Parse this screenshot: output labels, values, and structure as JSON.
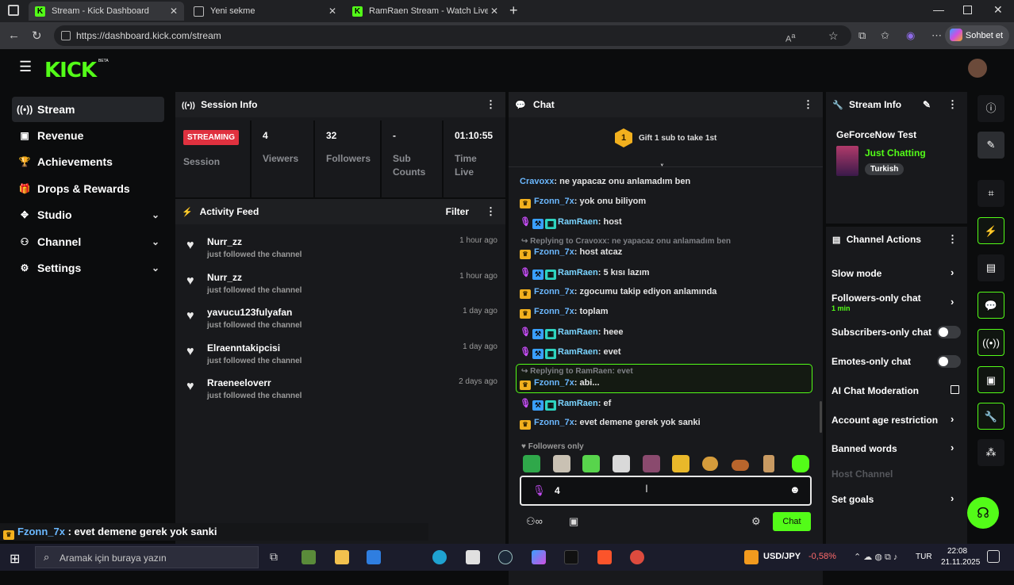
{
  "browser": {
    "tabs": [
      {
        "label": "Stream - Kick Dashboard",
        "active": true
      },
      {
        "label": "Yeni sekme",
        "active": false
      },
      {
        "label": "RamRaen Stream - Watch Live on",
        "active": false
      }
    ],
    "url": "https://dashboard.kick.com/stream",
    "sohbet_label": "Sohbet et"
  },
  "brand": {
    "logo": "KICK",
    "beta": "BETA",
    "accent": "#53fc18"
  },
  "sidebar": {
    "items": [
      {
        "label": "Stream",
        "icon": "broadcast-icon",
        "active": true
      },
      {
        "label": "Revenue",
        "icon": "wallet-icon"
      },
      {
        "label": "Achievements",
        "icon": "trophy-icon"
      },
      {
        "label": "Drops & Rewards",
        "icon": "gift-icon"
      },
      {
        "label": "Studio",
        "icon": "studio-icon",
        "expandable": true
      },
      {
        "label": "Channel",
        "icon": "users-icon",
        "expandable": true
      },
      {
        "label": "Settings",
        "icon": "gear-icon",
        "expandable": true
      }
    ]
  },
  "session": {
    "title": "Session Info",
    "status": "STREAMING",
    "status_label": "Session",
    "viewers": "4",
    "viewers_label": "Viewers",
    "followers": "32",
    "followers_label": "Followers",
    "subs": "-",
    "subs_label_1": "Sub",
    "subs_label_2": "Counts",
    "time": "01:10:55",
    "time_label_1": "Time",
    "time_label_2": "Live"
  },
  "activity": {
    "title": "Activity Feed",
    "filter": "Filter",
    "items": [
      {
        "name": "Nurr_zz",
        "desc": "just followed the channel",
        "time": "1 hour ago"
      },
      {
        "name": "Nurr_zz",
        "desc": "just followed the channel",
        "time": "1 hour ago"
      },
      {
        "name": "yavucu123fulyafan",
        "desc": "just followed the channel",
        "time": "1 day ago"
      },
      {
        "name": "Elraenntakipcisi",
        "desc": "just followed the channel",
        "time": "1 day ago"
      },
      {
        "name": "Rraeneeloverr",
        "desc": "just followed the channel",
        "time": "2 days ago"
      }
    ]
  },
  "chat": {
    "title": "Chat",
    "gift_count": "1",
    "gift_text": "Gift 1 sub to take 1st",
    "messages": [
      {
        "user": "Cravoxx",
        "text": ": ne yapacaz onu anlamadım ben",
        "type": "plain"
      },
      {
        "user": "Fzonn_7x",
        "text": ": yok onu biliyom",
        "type": "crown"
      },
      {
        "user": "RamRaen",
        "text": ": host",
        "type": "host"
      },
      {
        "user": "Fzonn_7x",
        "text": ": host atcaz",
        "type": "crown",
        "reply": "Replying to Cravoxx: ne yapacaz onu anlamadım ben"
      },
      {
        "user": "RamRaen",
        "text": ": 5 kısı lazım",
        "type": "host"
      },
      {
        "user": "Fzonn_7x",
        "text": ": zgocumu takip ediyon anlamında",
        "type": "crown"
      },
      {
        "user": "Fzonn_7x",
        "text": ": toplam",
        "type": "crown"
      },
      {
        "user": "RamRaen",
        "text": ": heee",
        "type": "host"
      },
      {
        "user": "RamRaen",
        "text": ": evet",
        "type": "host"
      },
      {
        "user": "Fzonn_7x",
        "text": ": abi...",
        "type": "crown",
        "reply": "Replying to RamRaen: evet",
        "highlight": true
      },
      {
        "user": "RamRaen",
        "text": ": ef",
        "type": "host"
      },
      {
        "user": "Fzonn_7x",
        "text": ": evet demene gerek yok sanki",
        "type": "crown"
      }
    ],
    "followers_only": "Followers only",
    "input_value": "4",
    "send_label": "Chat"
  },
  "stream_info": {
    "title": "Stream Info",
    "stream_title": "GeForceNow Test",
    "category": "Just Chatting",
    "tag": "Turkish"
  },
  "channel_actions": {
    "title": "Channel Actions",
    "items": [
      {
        "label": "Slow mode",
        "control": "chevron"
      },
      {
        "label": "Followers-only chat",
        "sub": "1 min",
        "control": "chevron"
      },
      {
        "label": "Subscribers-only chat",
        "control": "toggle"
      },
      {
        "label": "Emotes-only chat",
        "control": "toggle"
      },
      {
        "label": "AI Chat Moderation",
        "control": "external"
      },
      {
        "label": "Account age restriction",
        "control": "chevron"
      },
      {
        "label": "Banned words",
        "control": "chevron"
      },
      {
        "label": "Host Channel",
        "control": "none",
        "disabled": true
      },
      {
        "label": "Set goals",
        "control": "chevron"
      }
    ]
  },
  "overlay": {
    "user": "Fzonn_7x",
    "text": " : evet demene gerek yok sanki"
  },
  "taskbar": {
    "search_placeholder": "Aramak için buraya yazın",
    "ticker": "USD/JPY",
    "change": "-0,58%",
    "lang": "TUR",
    "time": "22:08",
    "date": "21.11.2025"
  }
}
